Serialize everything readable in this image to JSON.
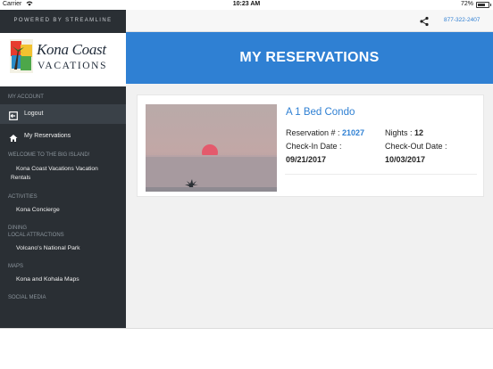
{
  "status_bar": {
    "carrier": "Carrier",
    "time": "10:23 AM",
    "battery": "72%",
    "battery_level": 0.72
  },
  "sidebar": {
    "powered_by": "POWERED BY STREAMLINE",
    "logo_line1": "Kona Coast",
    "logo_line2": "VACATIONS",
    "sections": {
      "my_account": "MY ACCOUNT",
      "welcome": "WELCOME TO THE BIG ISLAND!",
      "activities": "ACTIVITIES",
      "dining": "DINING",
      "local_attractions": "LOCAL ATTRACTIONS",
      "maps": "MAPS",
      "social_media": "SOCIAL MEDIA"
    },
    "items": {
      "logout": "Logout",
      "my_reservations": "My Reservations",
      "vacation_rentals_1": "Kona Coast Vacations Vacation",
      "vacation_rentals_2": "Rentals",
      "concierge": "Kona Concierge",
      "volcano": "Volcano's National Park",
      "maps": "Kona and Kohala Maps"
    }
  },
  "topbar": {
    "phone": "877-322-2407",
    "share_icon": "share-icon"
  },
  "header": {
    "title": "MY RESERVATIONS"
  },
  "reservation": {
    "title": "A 1 Bed Condo",
    "reservation_label": "Reservation # : ",
    "reservation_number": "21027",
    "nights_label": "Nights : ",
    "nights": "12",
    "checkin_label": "Check-In Date :",
    "checkin": "09/21/2017",
    "checkout_label": "Check-Out Date :",
    "checkout": "10/03/2017"
  },
  "colors": {
    "accent": "#2f80d3",
    "sidebar_bg": "#2a2f34"
  }
}
